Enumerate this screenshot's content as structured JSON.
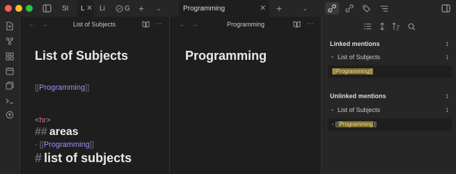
{
  "window": {
    "tabs": [
      {
        "label": "St"
      },
      {
        "label": "L"
      },
      {
        "label": "Li"
      },
      {
        "label": "G"
      },
      {
        "label": "Programming"
      }
    ],
    "new_tab_symbol": "+"
  },
  "left_pane": {
    "nav_title": "List of Subjects",
    "title": "List of Subjects",
    "link_line": {
      "open": "[[",
      "link": "Programming",
      "close": "]]"
    },
    "hr_line": {
      "lt": "<",
      "name": "hr",
      "gt": ">"
    },
    "areas_heading": {
      "mark": "##",
      "text": "areas"
    },
    "areas_item": {
      "prefix": "- [[",
      "link": "Programming",
      "close": "]]"
    },
    "subjects_heading": {
      "mark": "#",
      "text": "list of subjects"
    }
  },
  "mid_pane": {
    "nav_title": "Programming",
    "title": "Programming"
  },
  "backlinks": {
    "linked": {
      "header": "Linked mentions",
      "count": "1",
      "file_name": "List of Subjects",
      "file_count": "1",
      "snippet": {
        "open": "[[",
        "link": "Programming",
        "close": "]]"
      }
    },
    "unlinked": {
      "header": "Unlinked mentions",
      "count": "1",
      "file_name": "List of Subjects",
      "file_count": "1",
      "snippet": {
        "prefix": "- [[",
        "link": "Programming",
        "close": "]]"
      }
    }
  },
  "colors": {
    "accent": "#a88bfa",
    "highlight": "#7a6a2a",
    "hr_tag": "#e06c75"
  }
}
